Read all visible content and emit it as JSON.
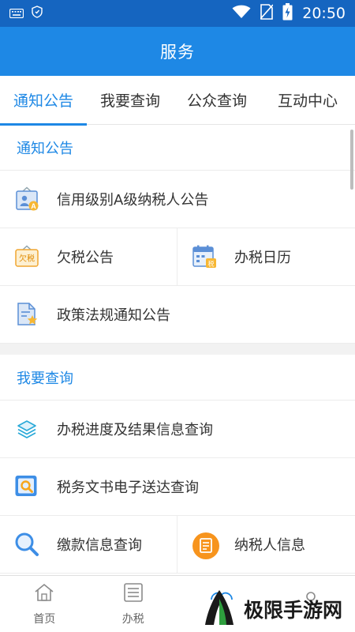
{
  "status_bar": {
    "time": "20:50",
    "icons": [
      "keyboard-icon",
      "shield-icon",
      "wifi-icon",
      "no-sim-icon",
      "battery-charging-icon"
    ]
  },
  "app_bar": {
    "title": "服务"
  },
  "tabs": [
    {
      "label": "通知公告",
      "selected": true
    },
    {
      "label": "我要查询",
      "selected": false
    },
    {
      "label": "公众查询",
      "selected": false
    },
    {
      "label": "互动中心",
      "selected": false
    }
  ],
  "sections": {
    "notice": {
      "title": "通知公告",
      "items": [
        {
          "label": "信用级别A级纳税人公告",
          "icon": "credit-level-board-icon"
        },
        {
          "label": "欠税公告",
          "icon": "tax-arrears-board-icon",
          "icon_text": "欠税"
        },
        {
          "label": "办税日历",
          "icon": "tax-calendar-icon",
          "icon_text": "税"
        },
        {
          "label": "政策法规通知公告",
          "icon": "policy-document-icon"
        }
      ]
    },
    "query": {
      "title": "我要查询",
      "items": [
        {
          "label": "办税进度及结果信息查询",
          "icon": "layers-icon"
        },
        {
          "label": "税务文书电子送达查询",
          "icon": "document-search-icon"
        },
        {
          "label": "缴款信息查询",
          "icon": "search-icon"
        },
        {
          "label": "纳税人信息",
          "icon": "taxpayer-info-icon"
        }
      ]
    }
  },
  "bottom_nav": [
    {
      "label": "首页",
      "icon": "home-icon"
    },
    {
      "label": "办税",
      "icon": "list-icon"
    },
    {
      "label": "",
      "icon": "cloud-icon"
    },
    {
      "label": "",
      "icon": "person-icon"
    }
  ],
  "watermark": {
    "text": "极限手游网"
  },
  "colors": {
    "status_bar": "#1565c0",
    "app_bar": "#1e88e5",
    "accent": "#1e88e5",
    "divider": "#ececec",
    "section_gap": "#f2f2f2"
  }
}
